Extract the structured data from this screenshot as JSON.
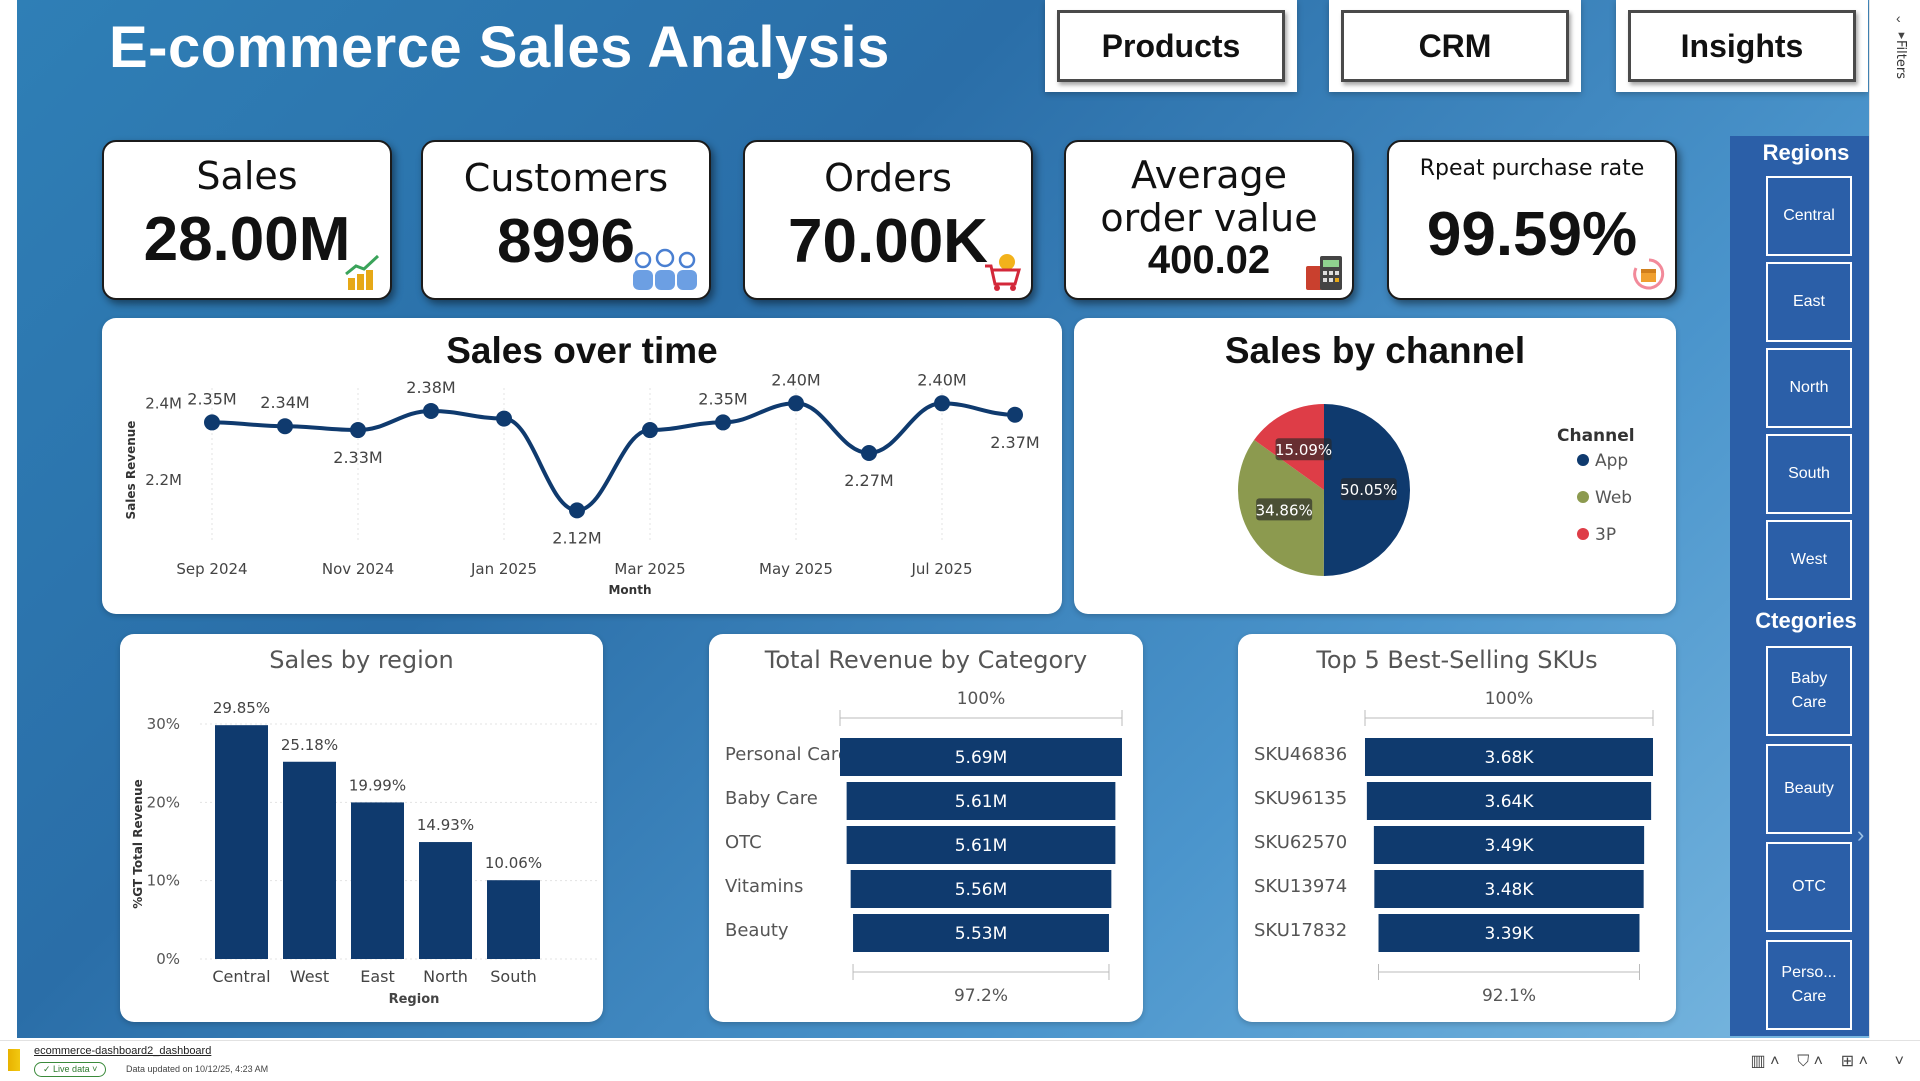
{
  "header": {
    "title": "E-commerce Sales Analysis"
  },
  "nav": {
    "products": "Products",
    "crm": "CRM",
    "insights": "Insights"
  },
  "kpis": {
    "sales": {
      "label": "Sales",
      "value": "28.00M",
      "icon": "growth-chart-icon"
    },
    "customers": {
      "label": "Customers",
      "value": "8996",
      "icon": "customers-icon"
    },
    "orders": {
      "label": "Orders",
      "value": "70.00K",
      "icon": "cart-icon"
    },
    "aov": {
      "label1": "Average",
      "label2": "order value",
      "value": "400.02",
      "icon": "calculator-icon"
    },
    "repeat": {
      "label": "Rpeat purchase rate",
      "value": "99.59%",
      "icon": "repeat-box-icon"
    }
  },
  "sales_over_time": {
    "title": "Sales over time"
  },
  "sales_by_channel": {
    "title": "Sales by channel",
    "legend_title": "Channel"
  },
  "sales_by_region": {
    "title": "Sales by region"
  },
  "revenue_by_category": {
    "title": "Total Revenue by Category",
    "top_pct": "100%",
    "bottom_pct": "97.2%"
  },
  "top_skus": {
    "title": "Top 5 Best-Selling SKUs",
    "top_pct": "100%",
    "bottom_pct": "92.1%"
  },
  "slicer": {
    "regions_title": "Regions",
    "regions": [
      "Central",
      "East",
      "North",
      "South",
      "West"
    ],
    "categories_title": "Ctegories",
    "categories": [
      "Baby\nCare",
      "Beauty",
      "OTC",
      "Perso...\nCare"
    ]
  },
  "filters_label": "Filters",
  "status": {
    "file": "ecommerce-dashboard2_dashboard",
    "live": "Live data",
    "updated": "Data updated on 10/12/25, 4:23 AM"
  },
  "colors": {
    "navy": "#0f3a6e",
    "olive": "#8c9a4f",
    "red": "#de3d47",
    "slicer": "#2b5fa8"
  },
  "chart_data": [
    {
      "type": "line",
      "title": "Sales over time",
      "xlabel": "Month",
      "ylabel": "Sales Revenue",
      "x": [
        "Sep 2024",
        "Oct 2024",
        "Nov 2024",
        "Dec 2024",
        "Jan 2025",
        "Feb 2025",
        "Mar 2025",
        "Apr 2025",
        "May 2025",
        "Jun 2025",
        "Jul 2025",
        "Aug 2025"
      ],
      "x_ticks": [
        "Sep 2024",
        "Nov 2024",
        "Jan 2025",
        "Mar 2025",
        "May 2025",
        "Jul 2025"
      ],
      "y_ticks": [
        "2.2M",
        "2.4M"
      ],
      "values": [
        2.35,
        2.34,
        2.33,
        2.38,
        2.36,
        2.12,
        2.33,
        2.35,
        2.4,
        2.27,
        2.4,
        2.37
      ],
      "labels": [
        "2.35M",
        "2.34M",
        "2.33M",
        "2.38M",
        "",
        "2.12M",
        "",
        "2.35M",
        "2.40M",
        "2.27M",
        "2.40M",
        "2.37M"
      ],
      "label_pos": [
        "above",
        "above",
        "below",
        "above",
        "",
        "below",
        "",
        "above",
        "above",
        "below",
        "above",
        "below"
      ],
      "ylim": [
        2.1,
        2.44
      ]
    },
    {
      "type": "pie",
      "title": "Sales by channel",
      "legend_title": "Channel",
      "categories": [
        "App",
        "Web",
        "3P"
      ],
      "values": [
        50.05,
        34.86,
        15.09
      ],
      "labels": [
        "50.05%",
        "34.86%",
        "15.09%"
      ],
      "colors": [
        "#0f3a6e",
        "#8c9a4f",
        "#de3d47"
      ]
    },
    {
      "type": "bar",
      "title": "Sales by region",
      "xlabel": "Region",
      "ylabel": "%GT Total Revenue",
      "categories": [
        "Central",
        "West",
        "East",
        "North",
        "South"
      ],
      "values": [
        29.85,
        25.18,
        19.99,
        14.93,
        10.06
      ],
      "labels": [
        "29.85%",
        "25.18%",
        "19.99%",
        "14.93%",
        "10.06%"
      ],
      "y_ticks": [
        "0%",
        "10%",
        "20%",
        "30%"
      ],
      "ylim": [
        0,
        30
      ]
    },
    {
      "type": "bar",
      "title": "Total Revenue by Category",
      "categories": [
        "Personal Care",
        "Baby Care",
        "OTC",
        "Vitamins",
        "Beauty"
      ],
      "values": [
        5.69,
        5.61,
        5.61,
        5.56,
        5.53
      ],
      "labels": [
        "5.69M",
        "5.61M",
        "5.61M",
        "5.56M",
        "5.53M"
      ]
    },
    {
      "type": "bar",
      "title": "Top 5 Best-Selling SKUs",
      "categories": [
        "SKU46836",
        "SKU96135",
        "SKU62570",
        "SKU13974",
        "SKU17832"
      ],
      "values": [
        3.68,
        3.64,
        3.49,
        3.48,
        3.39
      ],
      "labels": [
        "3.68K",
        "3.64K",
        "3.49K",
        "3.48K",
        "3.39K"
      ]
    }
  ]
}
